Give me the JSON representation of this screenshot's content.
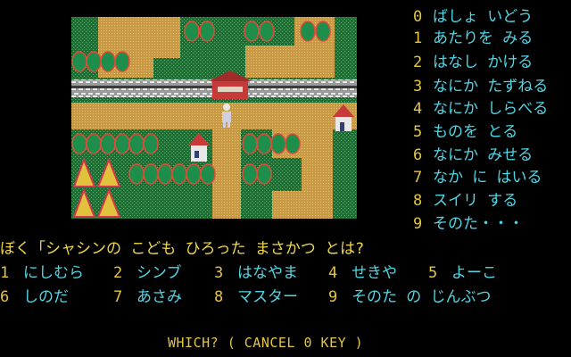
{
  "commands": [
    {
      "num": "0",
      "label": "ばしょ いどう"
    },
    {
      "num": "1",
      "label": "あたりを みる"
    },
    {
      "num": "2",
      "label": "はなし かける"
    },
    {
      "num": "3",
      "label": "なにか たずねる"
    },
    {
      "num": "4",
      "label": "なにか しらべる"
    },
    {
      "num": "5",
      "label": "ものを とる"
    },
    {
      "num": "6",
      "label": "なにか みせる"
    },
    {
      "num": "7",
      "label": "なか に はいる"
    },
    {
      "num": "8",
      "label": "スイリ する"
    },
    {
      "num": "9",
      "label": "そのた・・・"
    }
  ],
  "question": "ぼく「シャシンの こども ひろった まさかつ とは?",
  "options": [
    {
      "num": "1",
      "label": "にしむら"
    },
    {
      "num": "2",
      "label": "シンブ"
    },
    {
      "num": "3",
      "label": "はなやま"
    },
    {
      "num": "4",
      "label": "せきや"
    },
    {
      "num": "5",
      "label": "よーこ"
    },
    {
      "num": "6",
      "label": "しのだ"
    },
    {
      "num": "7",
      "label": "あさみ"
    },
    {
      "num": "8",
      "label": "マスター"
    },
    {
      "num": "9",
      "label": "そのた の じんぶつ"
    }
  ],
  "prompt": "WHICH? ( CANCEL 0 KEY )",
  "colors": {
    "number": "#e5c542",
    "text": "#52d6e6",
    "question": "#f0d84a",
    "road": "#c89b47",
    "grass": "#1f7a3a"
  }
}
